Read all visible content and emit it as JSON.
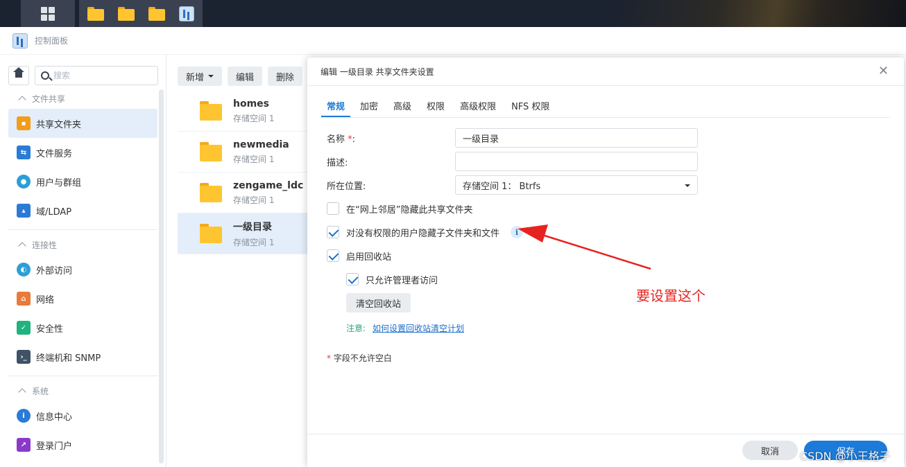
{
  "app": {
    "title": "控制面板"
  },
  "taskbar": {
    "apps": [
      "folder-icon",
      "folder-icon",
      "folder-icon",
      "control-panel-icon"
    ]
  },
  "sidebar": {
    "search_placeholder": "搜索",
    "sections": [
      {
        "title": "文件共享",
        "items": [
          {
            "label": "共享文件夹",
            "icon": "shared-folder-icon",
            "color": "#f39c1a",
            "active": true
          },
          {
            "label": "文件服务",
            "icon": "file-service-icon",
            "color": "#2b7bd6"
          },
          {
            "label": "用户与群组",
            "icon": "users-icon",
            "color": "#2b9fd6"
          },
          {
            "label": "域/LDAP",
            "icon": "ldap-icon",
            "color": "#2b7bd6"
          }
        ]
      },
      {
        "title": "连接性",
        "items": [
          {
            "label": "外部访问",
            "icon": "globe-icon",
            "color": "#2b9fd6"
          },
          {
            "label": "网络",
            "icon": "network-house-icon",
            "color": "#e87a3a"
          },
          {
            "label": "安全性",
            "icon": "shield-icon",
            "color": "#1fb37e"
          },
          {
            "label": "终端机和 SNMP",
            "icon": "terminal-icon",
            "color": "#3e5366"
          }
        ]
      },
      {
        "title": "系统",
        "items": [
          {
            "label": "信息中心",
            "icon": "info-icon",
            "color": "#2b7bd6"
          },
          {
            "label": "登录门户",
            "icon": "portal-icon",
            "color": "#8a3ac9"
          }
        ]
      }
    ]
  },
  "list": {
    "toolbar": {
      "create": "新增",
      "edit": "编辑",
      "delete": "删除"
    },
    "folders": [
      {
        "name": "homes",
        "location": "存储空间 1"
      },
      {
        "name": "newmedia",
        "location": "存储空间 1"
      },
      {
        "name": "zengame_ldc",
        "location": "存储空间 1"
      },
      {
        "name": "一级目录",
        "location": "存储空间 1",
        "active": true
      }
    ]
  },
  "dialog": {
    "title": "编辑 一级目录 共享文件夹设置",
    "tabs": [
      "常规",
      "加密",
      "高级",
      "权限",
      "高级权限",
      "NFS 权限"
    ],
    "active_tab": 0,
    "form": {
      "name_label": "名称",
      "name_req": "*",
      "name_colon": ":",
      "name_value": "一级目录",
      "desc_label": "描述:",
      "desc_value": "",
      "location_label": "所在位置:",
      "location_value": "存储空间 1： Btrfs",
      "hide_network": {
        "label": "在“网上邻居”隐藏此共享文件夹",
        "checked": false
      },
      "hide_subfolders": {
        "label": "对没有权限的用户隐藏子文件夹和文件",
        "checked": true
      },
      "recycle_bin": {
        "label": "启用回收站",
        "checked": true
      },
      "admin_only": {
        "label": "只允许管理者访问",
        "checked": true
      },
      "empty_recycle": "清空回收站",
      "note_label": "注意:",
      "note_link": "如何设置回收站清空计划",
      "req_star": "*",
      "req_note": " 字段不允许空白"
    },
    "footer": {
      "cancel": "取消",
      "save": "保存"
    }
  },
  "annotation": {
    "text": "要设置这个",
    "color": "#e52421"
  },
  "watermark": "CSDN @小王格子"
}
